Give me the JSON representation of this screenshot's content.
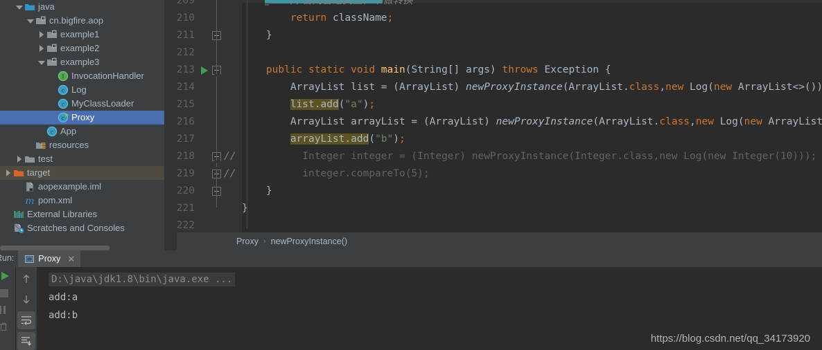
{
  "project_tree": {
    "items": [
      {
        "label": "java",
        "indent": 2,
        "arrow": "down",
        "icon": "folder-blue-icon",
        "state": "normal"
      },
      {
        "label": "cn.bigfire.aop",
        "indent": 3,
        "arrow": "down",
        "icon": "package-icon",
        "state": "normal"
      },
      {
        "label": "example1",
        "indent": 4,
        "arrow": "right",
        "icon": "package-icon",
        "state": "normal"
      },
      {
        "label": "example2",
        "indent": 4,
        "arrow": "right",
        "icon": "package-icon",
        "state": "normal"
      },
      {
        "label": "example3",
        "indent": 4,
        "arrow": "down",
        "icon": "package-icon",
        "state": "normal"
      },
      {
        "label": "InvocationHandler",
        "indent": 5,
        "arrow": "none",
        "icon": "interface-icon",
        "state": "normal"
      },
      {
        "label": "Log",
        "indent": 5,
        "arrow": "none",
        "icon": "class-icon",
        "state": "normal"
      },
      {
        "label": "MyClassLoader",
        "indent": 5,
        "arrow": "none",
        "icon": "class-icon",
        "state": "normal"
      },
      {
        "label": "Proxy",
        "indent": 5,
        "arrow": "none",
        "icon": "runnable-class-icon",
        "state": "selected"
      },
      {
        "label": "App",
        "indent": 4,
        "arrow": "none",
        "icon": "class-icon",
        "state": "normal"
      },
      {
        "label": "resources",
        "indent": 3,
        "arrow": "none",
        "icon": "resources-folder-icon",
        "state": "normal"
      },
      {
        "label": "test",
        "indent": 2,
        "arrow": "right",
        "icon": "folder-grey-icon",
        "state": "normal"
      },
      {
        "label": "target",
        "indent": 1,
        "arrow": "right",
        "icon": "folder-orange-icon",
        "state": "excluded"
      },
      {
        "label": "aopexample.iml",
        "indent": 2,
        "arrow": "none",
        "icon": "iml-file-icon",
        "state": "normal"
      },
      {
        "label": "pom.xml",
        "indent": 2,
        "arrow": "none",
        "icon": "maven-icon",
        "state": "normal"
      },
      {
        "label": "External Libraries",
        "indent": 1,
        "arrow": "none",
        "icon": "libraries-icon",
        "state": "normal"
      },
      {
        "label": "Scratches and Consoles",
        "indent": 1,
        "arrow": "none",
        "icon": "scratches-icon",
        "state": "normal"
      }
    ]
  },
  "editor": {
    "lines": [
      {
        "num": "209",
        "fold": "none",
        "run": false,
        "comment_marker": false,
        "tokens": [
          {
            "t": "        ",
            "c": "txt"
          },
          {
            "t": "//否则普通类型，不做转换",
            "c": "cmt"
          }
        ]
      },
      {
        "num": "210",
        "fold": "none",
        "run": false,
        "comment_marker": false,
        "tokens": [
          {
            "t": "        ",
            "c": "txt"
          },
          {
            "t": "return",
            "c": "kw"
          },
          {
            "t": " className",
            "c": "txt"
          },
          {
            "t": ";",
            "c": "semi"
          }
        ]
      },
      {
        "num": "211",
        "fold": "box-plain",
        "run": false,
        "comment_marker": false,
        "tokens": [
          {
            "t": "    }",
            "c": "txt"
          }
        ]
      },
      {
        "num": "212",
        "fold": "none",
        "run": false,
        "comment_marker": false,
        "tokens": []
      },
      {
        "num": "213",
        "fold": "box-down",
        "run": true,
        "comment_marker": false,
        "tokens": [
          {
            "t": "    ",
            "c": "txt"
          },
          {
            "t": "public static void ",
            "c": "kw"
          },
          {
            "t": "main",
            "c": "meth"
          },
          {
            "t": "(String[] args) ",
            "c": "txt"
          },
          {
            "t": "throws",
            "c": "kw"
          },
          {
            "t": " Exception {",
            "c": "txt"
          }
        ]
      },
      {
        "num": "214",
        "fold": "none",
        "run": false,
        "comment_marker": false,
        "tokens": [
          {
            "t": "        ArrayList list = (ArrayList) ",
            "c": "txt"
          },
          {
            "t": "newProxyInstance",
            "c": "static-italic"
          },
          {
            "t": "(ArrayList.",
            "c": "txt"
          },
          {
            "t": "class",
            "c": "kw"
          },
          {
            "t": ",",
            "c": "txt"
          },
          {
            "t": "new ",
            "c": "kw"
          },
          {
            "t": "Log(",
            "c": "txt"
          },
          {
            "t": "new ",
            "c": "kw"
          },
          {
            "t": "ArrayList<>())",
            "c": "txt"
          },
          {
            "t": ");",
            "c": "semi"
          }
        ]
      },
      {
        "num": "215",
        "fold": "none",
        "run": false,
        "comment_marker": false,
        "tokens": [
          {
            "t": "        ",
            "c": "txt"
          },
          {
            "t": "list.add",
            "c": "searchhl"
          },
          {
            "t": "(",
            "c": "txt"
          },
          {
            "t": "\"a\"",
            "c": "str"
          },
          {
            "t": ")",
            "c": "txt"
          },
          {
            "t": ";",
            "c": "semi"
          }
        ]
      },
      {
        "num": "216",
        "fold": "none",
        "run": false,
        "comment_marker": false,
        "tokens": [
          {
            "t": "        ArrayList arrayList = (ArrayList) ",
            "c": "txt"
          },
          {
            "t": "newProxyInstance",
            "c": "static-italic"
          },
          {
            "t": "(ArrayList.",
            "c": "txt"
          },
          {
            "t": "class",
            "c": "kw"
          },
          {
            "t": ",",
            "c": "txt"
          },
          {
            "t": "new ",
            "c": "kw"
          },
          {
            "t": "Log(",
            "c": "txt"
          },
          {
            "t": "new ",
            "c": "kw"
          },
          {
            "t": "ArrayList<>())",
            "c": "txt"
          },
          {
            "t": ");",
            "c": "semi"
          }
        ]
      },
      {
        "num": "217",
        "fold": "none",
        "run": false,
        "comment_marker": false,
        "tokens": [
          {
            "t": "        ",
            "c": "txt"
          },
          {
            "t": "arrayList.add",
            "c": "searchhl"
          },
          {
            "t": "(",
            "c": "txt"
          },
          {
            "t": "\"b\"",
            "c": "str"
          },
          {
            "t": ")",
            "c": "txt"
          },
          {
            "t": ";",
            "c": "semi"
          }
        ]
      },
      {
        "num": "218",
        "fold": "box-down",
        "run": false,
        "comment_marker": true,
        "tokens": [
          {
            "t": "          Integer integer = (Integer) newProxyInstance(Integer.class,new Log(new Integer(10)));",
            "c": "greyed"
          }
        ]
      },
      {
        "num": "219",
        "fold": "box-up",
        "run": false,
        "comment_marker": true,
        "tokens": [
          {
            "t": "          integer.compareTo(5);",
            "c": "greyed"
          }
        ]
      },
      {
        "num": "220",
        "fold": "box-plain",
        "run": false,
        "comment_marker": false,
        "tokens": [
          {
            "t": "    }",
            "c": "txt"
          }
        ]
      },
      {
        "num": "221",
        "fold": "none",
        "run": false,
        "comment_marker": false,
        "tokens": [
          {
            "t": "}",
            "c": "txt"
          }
        ]
      },
      {
        "num": "222",
        "fold": "none",
        "run": false,
        "comment_marker": false,
        "tokens": []
      }
    ],
    "breadcrumb": {
      "class": "Proxy",
      "separator": "›",
      "method": "newProxyInstance()"
    }
  },
  "run_panel": {
    "label": "Run:",
    "tab": {
      "title": "Proxy",
      "close": "✕"
    },
    "toolbar_left": [
      "rerun-icon",
      "stop-icon",
      "pause-icon",
      "trash-icon"
    ],
    "toolbar_right": [
      "up-arrow-icon",
      "down-arrow-icon",
      "soft-wrap-icon",
      "scroll-to-end-icon"
    ],
    "console": {
      "command": "D:\\java\\jdk1.8\\bin\\java.exe ...",
      "output": [
        "add:a",
        "add:b"
      ]
    }
  },
  "watermark": "https://blog.csdn.net/qq_34173920",
  "colors": {
    "selection_blue": "#4b6eaf",
    "excluded_olive": "#4f4b41",
    "editor_bg": "#2b2b2b",
    "panel_bg": "#3c3f41",
    "gutter_bg": "#313335",
    "keyword_orange": "#cc7832",
    "string_green": "#6a8759",
    "method_yellow": "#ffc66d",
    "search_highlight": "#5d5223",
    "run_green": "#499c54",
    "cyan_bar": "#3f93a5"
  }
}
